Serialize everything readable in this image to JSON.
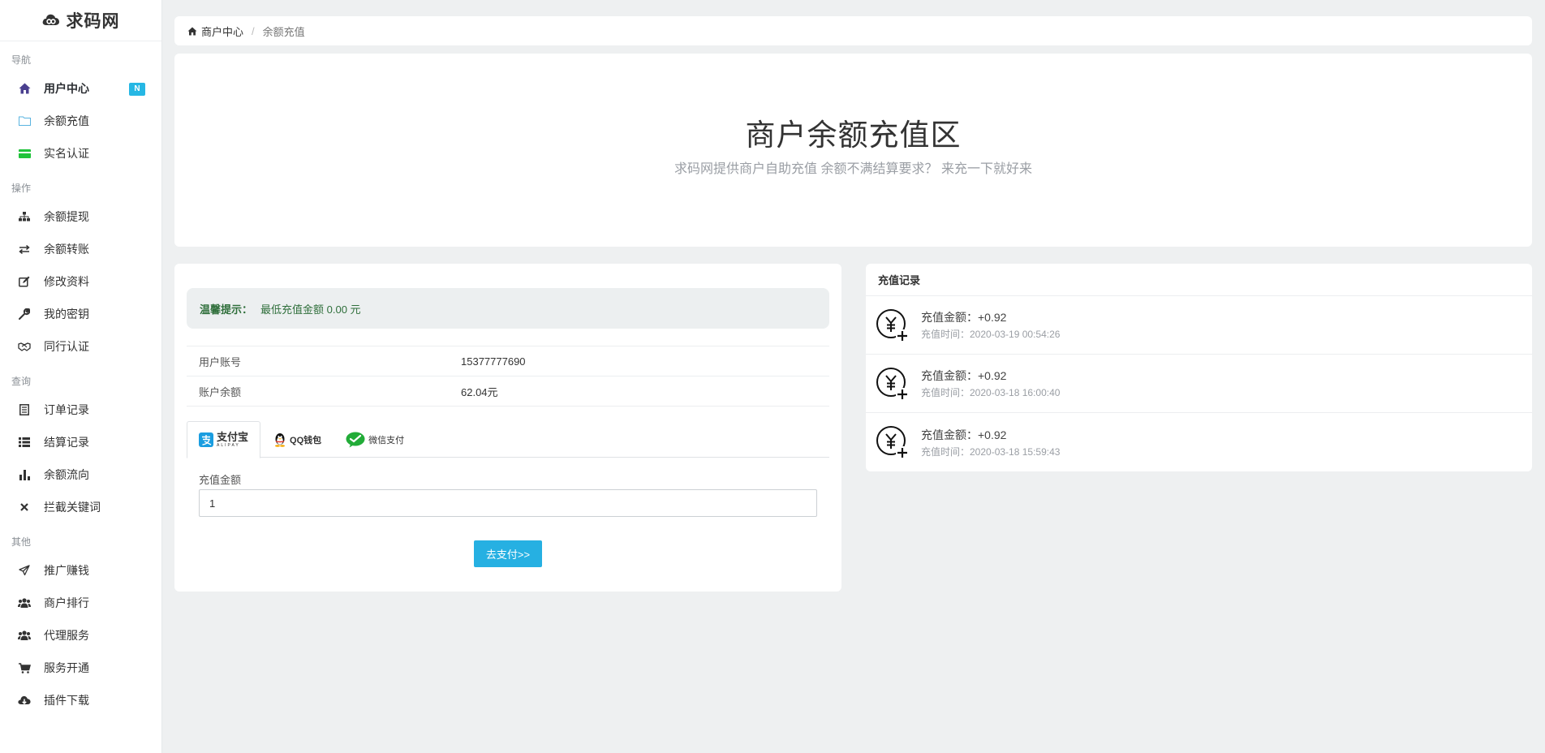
{
  "app": {
    "logo_text": "求码网"
  },
  "sidebar": {
    "sections": [
      {
        "title": "导航",
        "items": [
          {
            "label": "用户中心",
            "icon": "home-icon",
            "badge": "N"
          },
          {
            "label": "余额充值",
            "icon": "folder-icon"
          },
          {
            "label": "实名认证",
            "icon": "id-card-icon"
          }
        ]
      },
      {
        "title": "操作",
        "items": [
          {
            "label": "余额提现",
            "icon": "sitemap-icon"
          },
          {
            "label": "余额转账",
            "icon": "exchange-icon"
          },
          {
            "label": "修改资料",
            "icon": "edit-icon"
          },
          {
            "label": "我的密钥",
            "icon": "wrench-icon"
          },
          {
            "label": "同行认证",
            "icon": "handshake-icon"
          }
        ]
      },
      {
        "title": "查询",
        "items": [
          {
            "label": "订单记录",
            "icon": "list-alt-icon"
          },
          {
            "label": "结算记录",
            "icon": "list-icon"
          },
          {
            "label": "余额流向",
            "icon": "bar-chart-icon"
          },
          {
            "label": "拦截关键词",
            "icon": "close-icon"
          }
        ]
      },
      {
        "title": "其他",
        "items": [
          {
            "label": "推广赚钱",
            "icon": "paper-plane-icon"
          },
          {
            "label": "商户排行",
            "icon": "users-icon"
          },
          {
            "label": "代理服务",
            "icon": "users-icon"
          },
          {
            "label": "服务开通",
            "icon": "cart-icon"
          },
          {
            "label": "插件下载",
            "icon": "cloud-download-icon"
          }
        ]
      }
    ]
  },
  "breadcrumb": {
    "home": "商户中心",
    "current": "余额充值"
  },
  "hero": {
    "title": "商户余额充值区",
    "subtitle": "求码网提供商户自助充值 余额不满结算要求？ 来充一下就好来"
  },
  "recharge": {
    "tip_title": "温馨提示：",
    "tip_text": "最低充值金额 0.00 元",
    "account_label": "用户账号",
    "account_value": "15377777690",
    "balance_label": "账户余额",
    "balance_value": "62.04元",
    "tabs": [
      {
        "label": "支付宝",
        "sub": "ALIPAY"
      },
      {
        "label": "QQ钱包"
      },
      {
        "label": "微信支付"
      }
    ],
    "amount_label": "充值金额",
    "amount_value": "1",
    "pay_button": "去支付>>"
  },
  "records": {
    "title": "充值记录",
    "items": [
      {
        "amount": "充值金额：+0.92",
        "time": "充值时间：2020-03-19 00:54:26"
      },
      {
        "amount": "充值金额：+0.92",
        "time": "充值时间：2020-03-18 16:00:40"
      },
      {
        "amount": "充值金额：+0.92",
        "time": "充值时间：2020-03-18 15:59:43"
      }
    ]
  },
  "colors": {
    "accent": "#26b0e2",
    "badge": "#26b7e4",
    "tip_text": "#2f6f3b",
    "page_bg": "#eef0f1"
  }
}
